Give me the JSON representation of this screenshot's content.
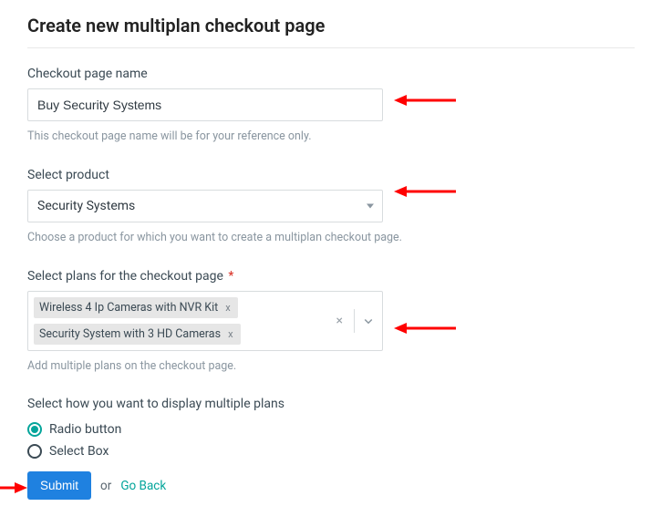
{
  "title": "Create new multiplan checkout page",
  "fields": {
    "name": {
      "label": "Checkout page name",
      "value": "Buy Security Systems",
      "help": "This checkout page name will be for your reference only."
    },
    "product": {
      "label": "Select product",
      "selected": "Security Systems",
      "help": "Choose a product for which you want to create a multiplan checkout page."
    },
    "plans": {
      "label": "Select plans for the checkout page",
      "required_mark": "*",
      "selected": [
        "Wireless 4 Ip Cameras with NVR Kit",
        "Security System with 3 HD Cameras"
      ],
      "chip_remove": "x",
      "clear_all": "×",
      "help": "Add multiple plans on the checkout page."
    },
    "display": {
      "label": "Select how you want to display multiple plans",
      "options": [
        {
          "key": "radio",
          "label": "Radio button",
          "selected": true
        },
        {
          "key": "select",
          "label": "Select Box",
          "selected": false
        }
      ]
    }
  },
  "actions": {
    "submit": "Submit",
    "or": "or",
    "go_back": "Go Back"
  },
  "colors": {
    "accent_teal": "#04a59b",
    "accent_blue": "#1f81e0",
    "annotation_red": "#ff0000"
  }
}
